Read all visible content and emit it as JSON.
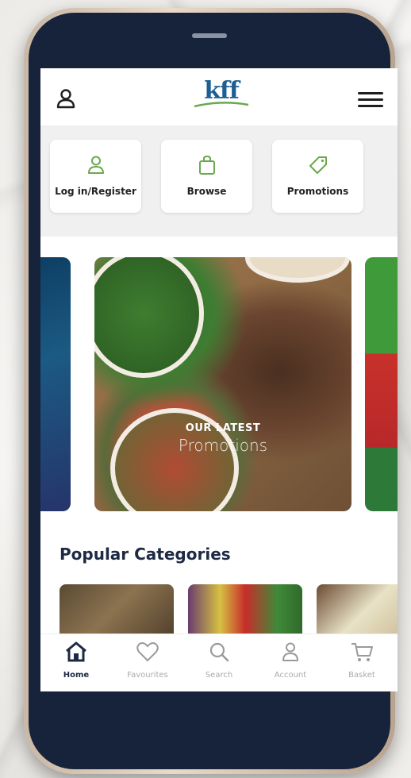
{
  "app": {
    "logo_text": "kff"
  },
  "quick_actions": [
    {
      "label": "Log in/Register",
      "icon": "user-icon"
    },
    {
      "label": "Browse",
      "icon": "bag-icon"
    },
    {
      "label": "Promotions",
      "icon": "tag-icon"
    }
  ],
  "banner": {
    "line1": "OUR LATEST",
    "line2": "Promotions"
  },
  "categories": {
    "title": "Popular Categories"
  },
  "tabs": [
    {
      "label": "Home",
      "icon": "home-icon",
      "active": true
    },
    {
      "label": "Favourites",
      "icon": "heart-icon"
    },
    {
      "label": "Search",
      "icon": "search-icon"
    },
    {
      "label": "Account",
      "icon": "user-icon"
    },
    {
      "label": "Basket",
      "icon": "cart-icon"
    }
  ],
  "colors": {
    "accent_green": "#6aa84f",
    "brand_blue": "#1d5f95",
    "navy": "#1d2a44"
  }
}
